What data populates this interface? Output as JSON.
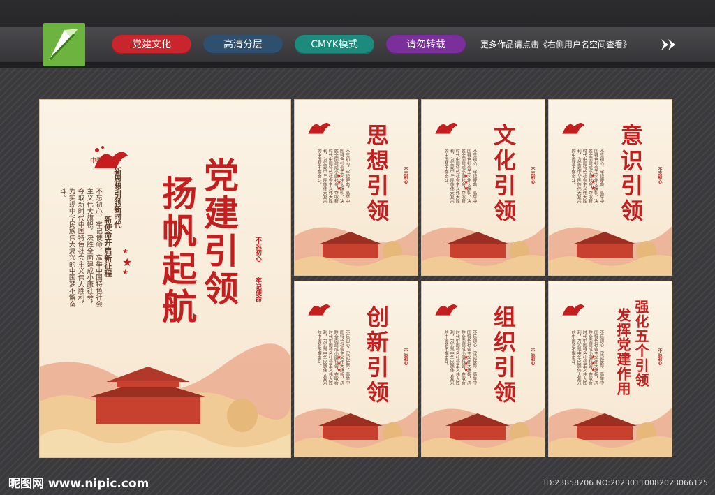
{
  "toolbar": {
    "tags": [
      {
        "label": "党建文化",
        "color": "#c8252d"
      },
      {
        "label": "高清分层",
        "color": "#2f4f6f"
      },
      {
        "label": "CMYK模式",
        "color": "#1d8a7e"
      },
      {
        "label": "请勿转载",
        "color": "#7b2f9a"
      }
    ],
    "tagline": "更多作品请点击《右侧用户名空间查看》"
  },
  "main_poster": {
    "logo_text": "中国梦",
    "title_line1": "党建引领",
    "title_line2": "扬帆起航",
    "seal_line1": "不忘初心",
    "seal_line2": "牢记使命",
    "sub_line1": "新思想引领新时代",
    "sub_line2": "新使命开启新征程",
    "body": "不忘初心，牢记使命，高举中国特色社会主义伟大旗帜，决胜全面建成小康社会，夺取新时代中国特色社会主义伟大胜利，为实现中华民族伟大复兴的中国梦不懈奋斗。"
  },
  "small_posters": [
    {
      "title": "思想引领"
    },
    {
      "title": "文化引领"
    },
    {
      "title": "意识引领"
    },
    {
      "title": "创新引领"
    },
    {
      "title": "组织引领"
    },
    {
      "title_line1": "强化五个引领",
      "title_line2": "发挥党建作用"
    }
  ],
  "footer": {
    "brand": "昵图网 www.nipic.com",
    "id": "ID:23858206 NO:20230110082023066125"
  },
  "colors": {
    "accent_red": "#c41e1e",
    "poster_bg": "#f8ecd9",
    "cloud_gold": "#e9c48a"
  }
}
